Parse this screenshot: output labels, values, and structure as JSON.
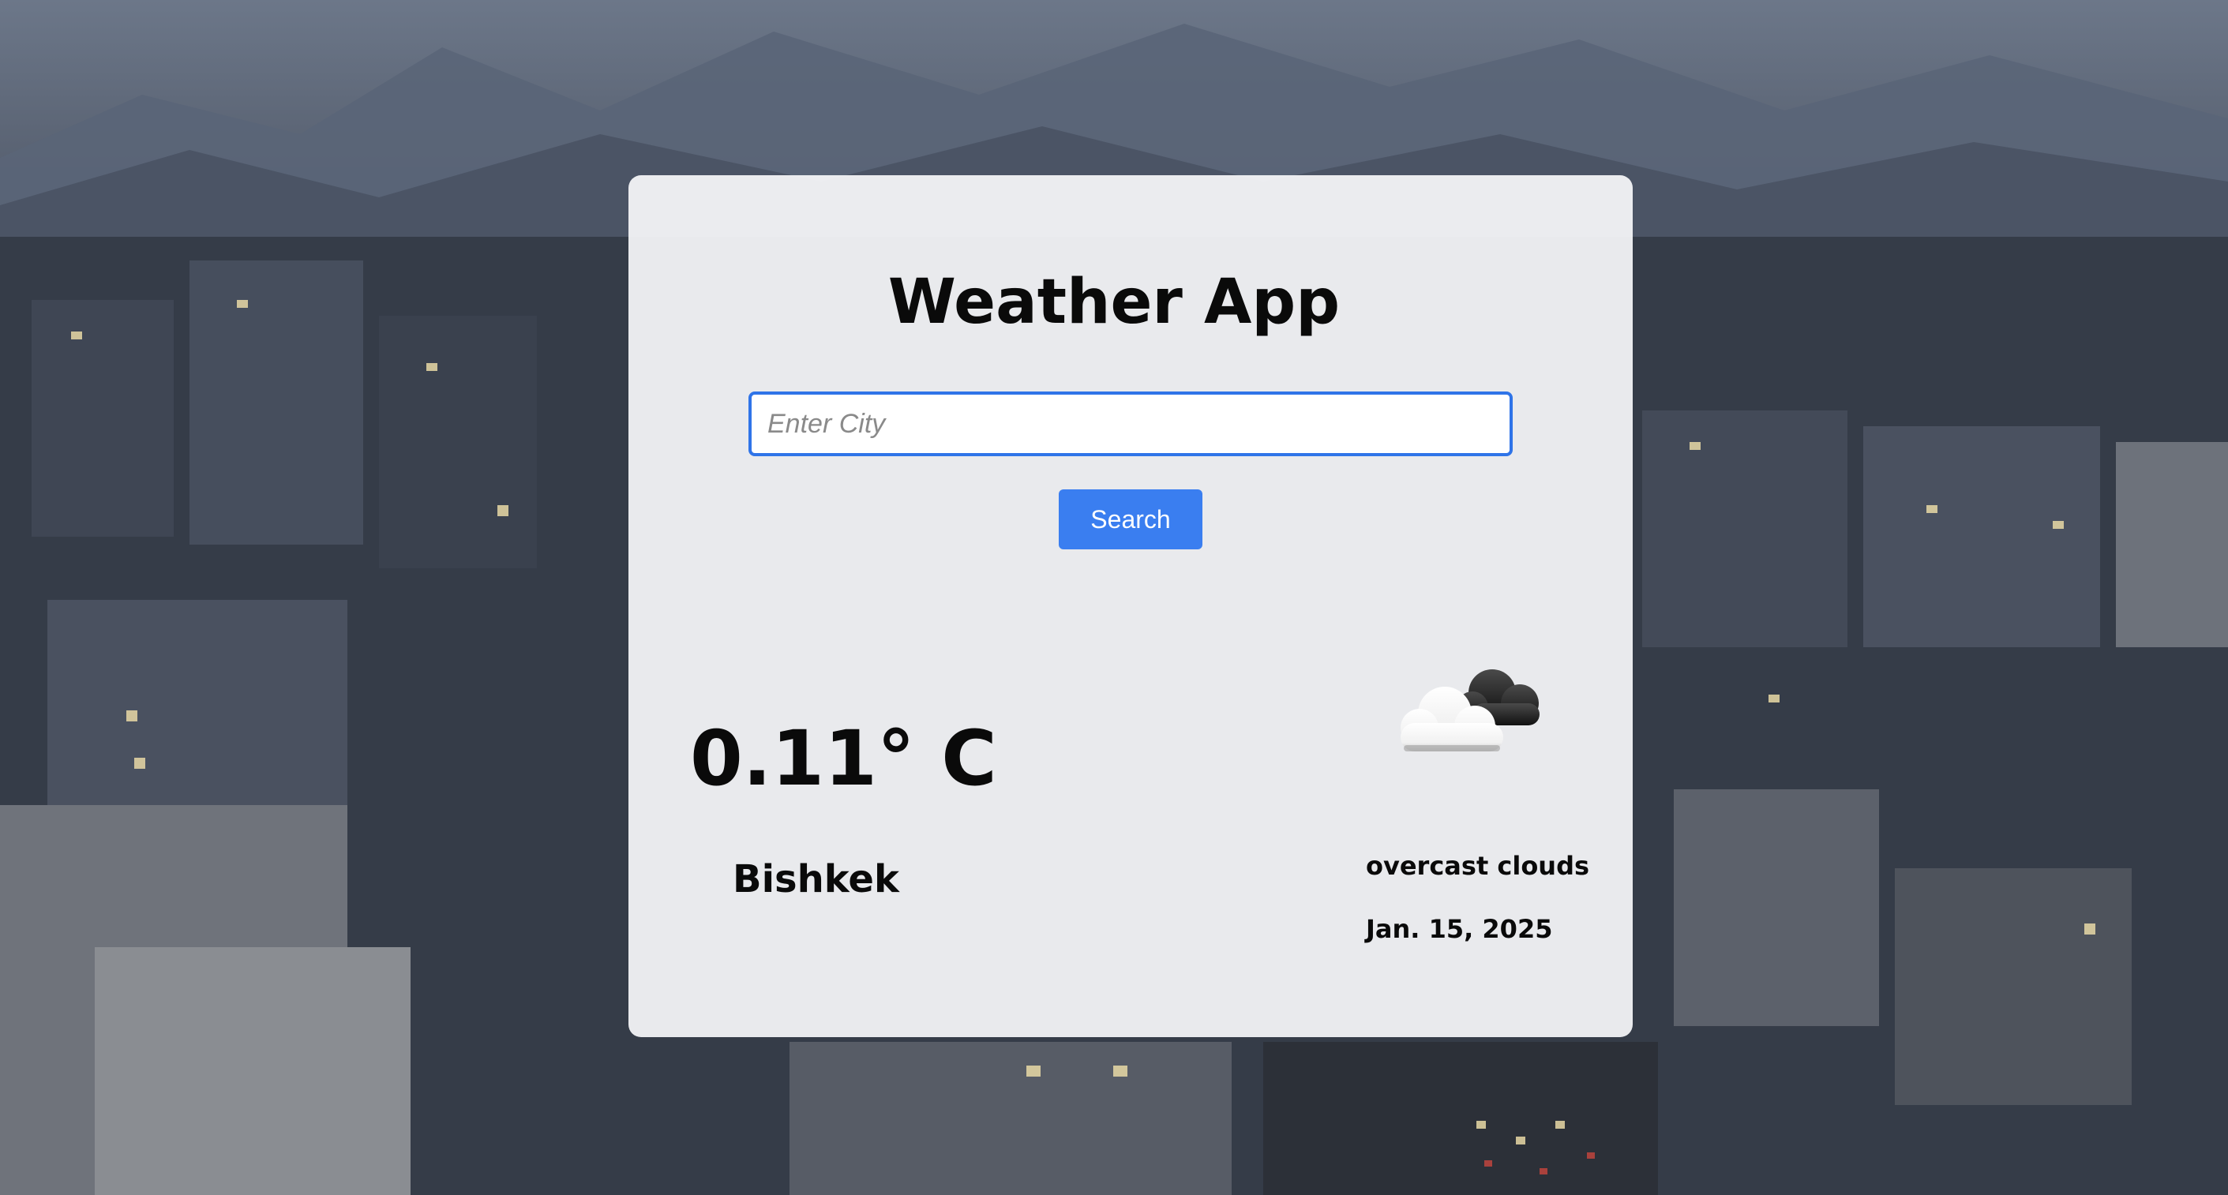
{
  "app": {
    "title": "Weather App"
  },
  "search": {
    "placeholder": "Enter City",
    "value": "",
    "button_label": "Search"
  },
  "weather": {
    "temperature": "0.11° C",
    "city": "Bishkek",
    "description": "overcast clouds",
    "date": "Jan. 15, 2025",
    "icon": "cloud-overcast-icon"
  },
  "colors": {
    "accent": "#3a7ef0",
    "input_border": "#2f74e8",
    "card_background": "#f8f8fa"
  }
}
